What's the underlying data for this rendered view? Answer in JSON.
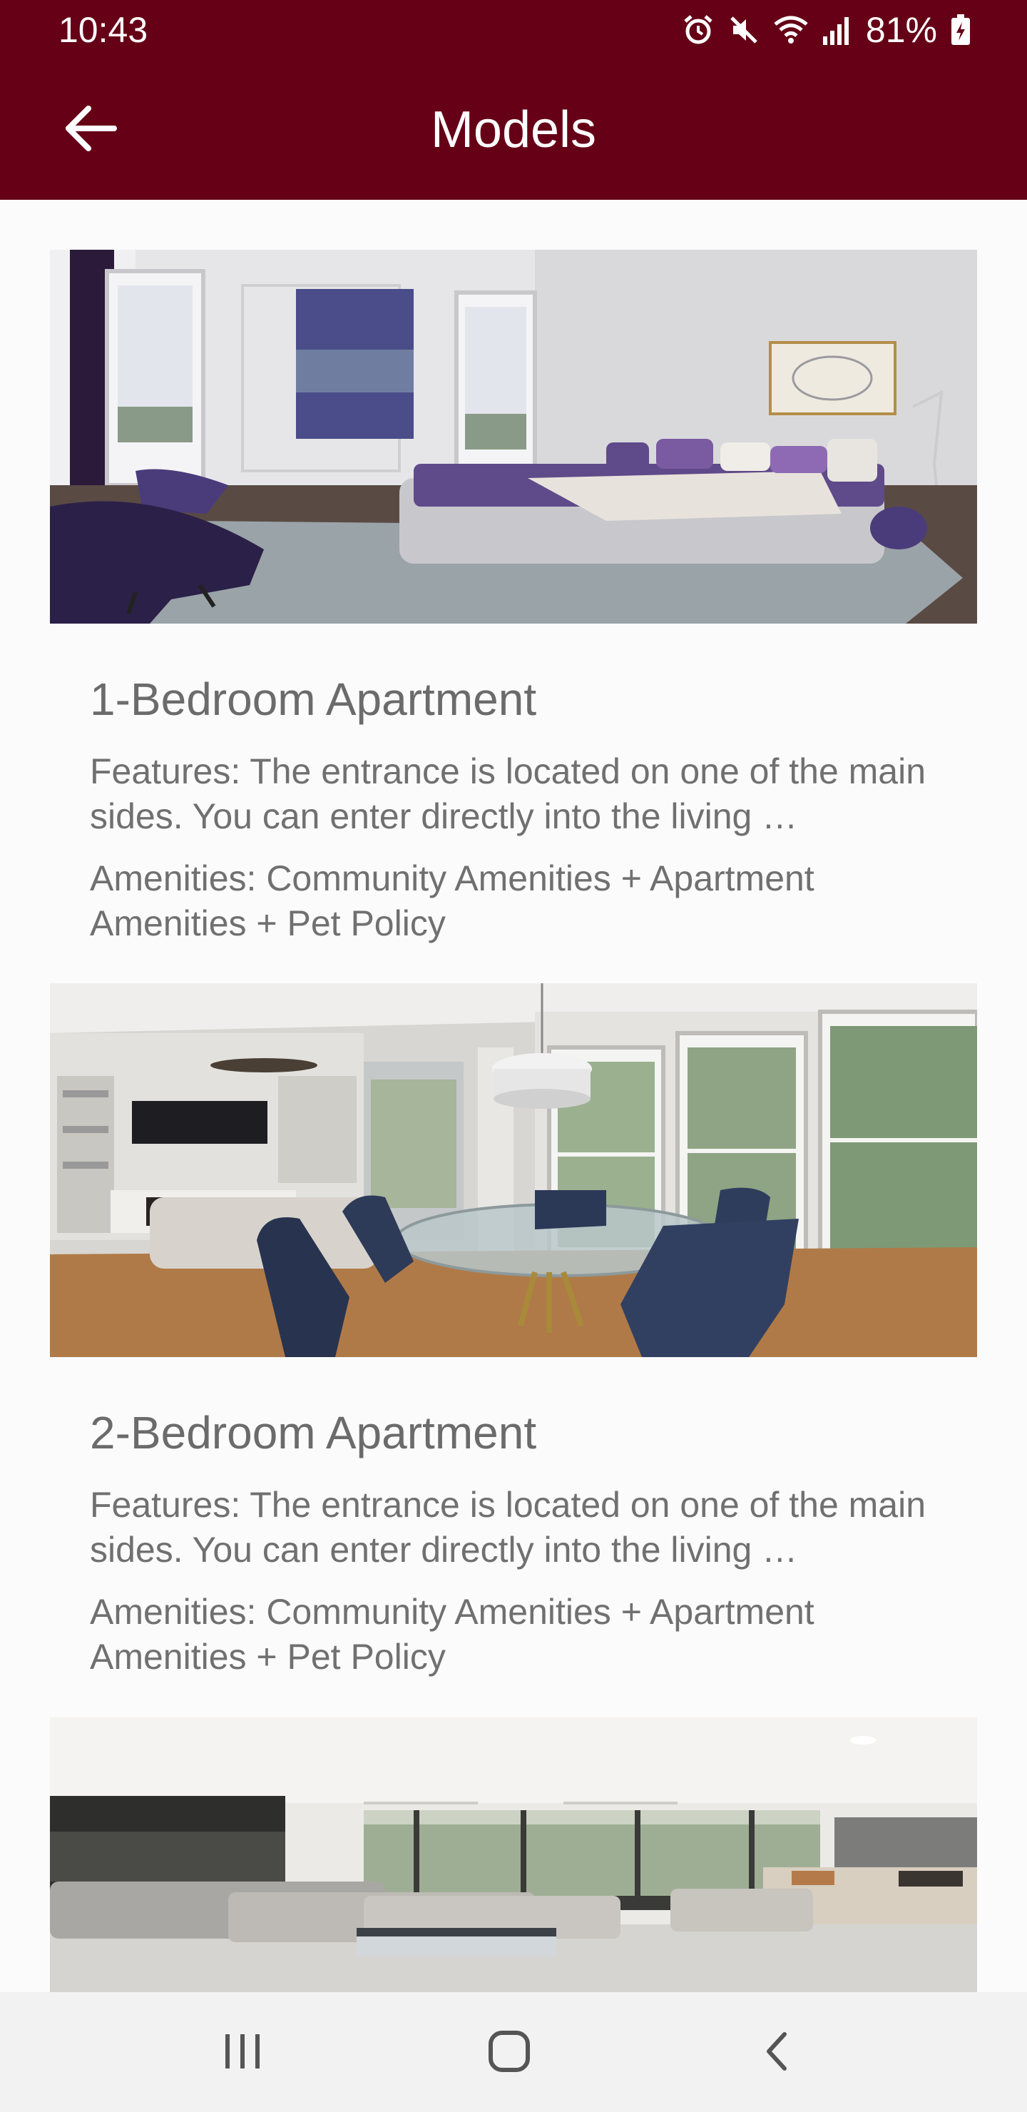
{
  "status_bar": {
    "time": "10:43",
    "battery": "81%",
    "icons": [
      "alarm-icon",
      "mute-icon",
      "wifi-icon",
      "signal-icon",
      "battery-charging-icon"
    ]
  },
  "app_bar": {
    "title": "Models",
    "back_icon": "arrow-left-icon"
  },
  "models": [
    {
      "title": "1-Bedroom Apartment",
      "features": "Features: The entrance is located on one of the main sides. You can enter directly into the living …",
      "amenities": "Amenities: Community Amenities + Apartment Amenities + Pet Policy",
      "image": "bedroom-photo"
    },
    {
      "title": "2-Bedroom Apartment",
      "features": "Features: The entrance is located on one of the main sides. You can enter directly into the living …",
      "amenities": "Amenities: Community Amenities + Apartment Amenities + Pet Policy",
      "image": "dining-room-photo"
    },
    {
      "image": "living-room-photo"
    }
  ],
  "nav_bar": {
    "icons": [
      "recent-apps-icon",
      "home-icon",
      "back-icon"
    ]
  },
  "colors": {
    "primary": "#650016",
    "text_secondary": "#707070",
    "background": "#fbfbfb"
  }
}
